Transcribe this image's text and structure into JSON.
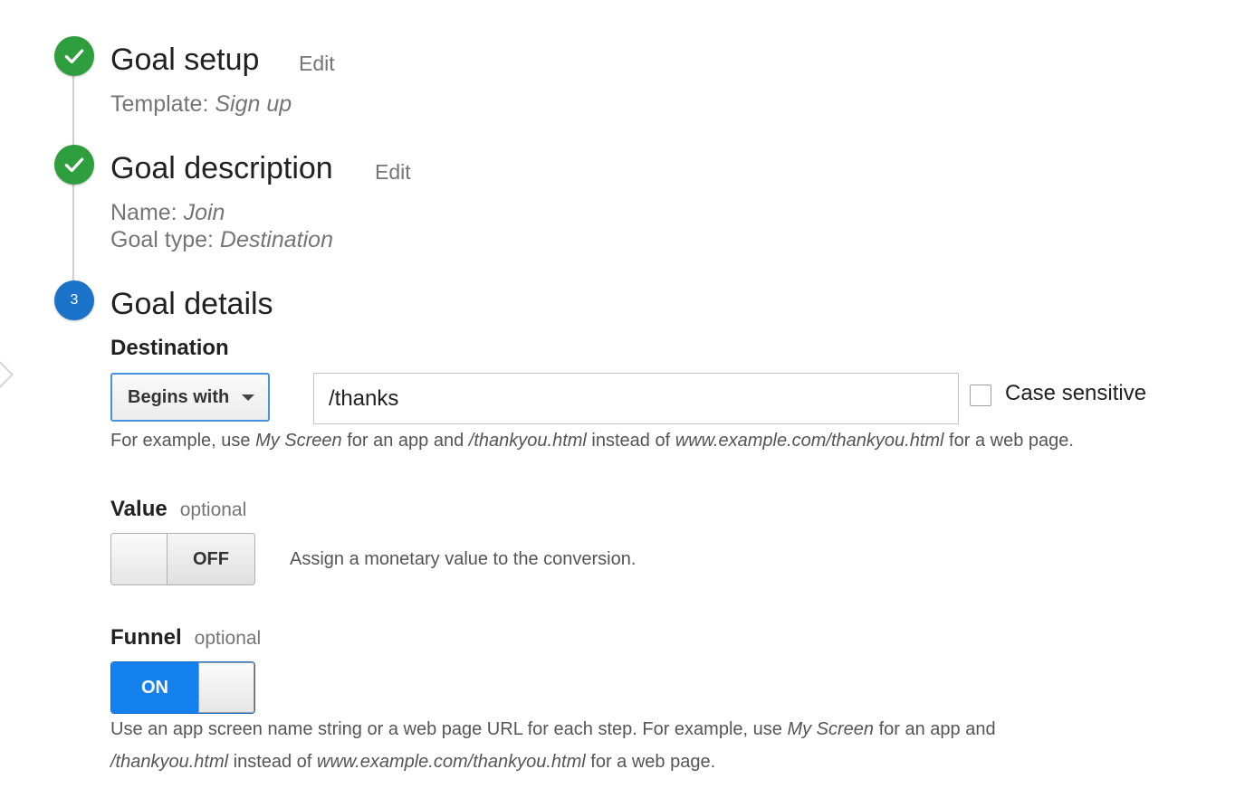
{
  "steps": [
    {
      "title": "Goal setup",
      "edit_label": "Edit",
      "status": "complete",
      "template_label": "Template:",
      "template_value": "Sign up"
    },
    {
      "title": "Goal description",
      "edit_label": "Edit",
      "status": "complete",
      "name_label": "Name:",
      "name_value": "Join",
      "type_label": "Goal type:",
      "type_value": "Destination"
    },
    {
      "number": "3",
      "title": "Goal details",
      "status": "current"
    }
  ],
  "destination": {
    "label": "Destination",
    "match_type": "Begins with",
    "value": "/thanks",
    "case_sensitive_label": "Case sensitive",
    "case_sensitive_checked": false,
    "help": {
      "p1": "For example, use ",
      "e1": "My Screen",
      "p2": " for an app and ",
      "e2": "/thankyou.html",
      "p3": " instead of ",
      "e3": "www.example.com/thankyou.html",
      "p4": " for a web page."
    }
  },
  "value_section": {
    "label": "Value",
    "optional": "optional",
    "toggle_state": "OFF",
    "description": "Assign a monetary value to the conversion."
  },
  "funnel_section": {
    "label": "Funnel",
    "optional": "optional",
    "toggle_state": "ON",
    "help": {
      "p1": "Use an app screen name string or a web page URL for each step. For example, use ",
      "e1": "My Screen",
      "p2": " for an app and",
      "e2": "/thankyou.html",
      "p3": " instead of ",
      "e3": "www.example.com/thankyou.html",
      "p4": " for a web page."
    }
  },
  "colors": {
    "step_complete": "#2e9e3e",
    "step_current": "#1b72c9",
    "toggle_on": "#1480ee",
    "select_border": "#4a90e2"
  },
  "icons": {
    "step_complete": "checkmark-icon",
    "dropdown": "caret-down-icon",
    "side_nav": "chevron-right-icon"
  }
}
